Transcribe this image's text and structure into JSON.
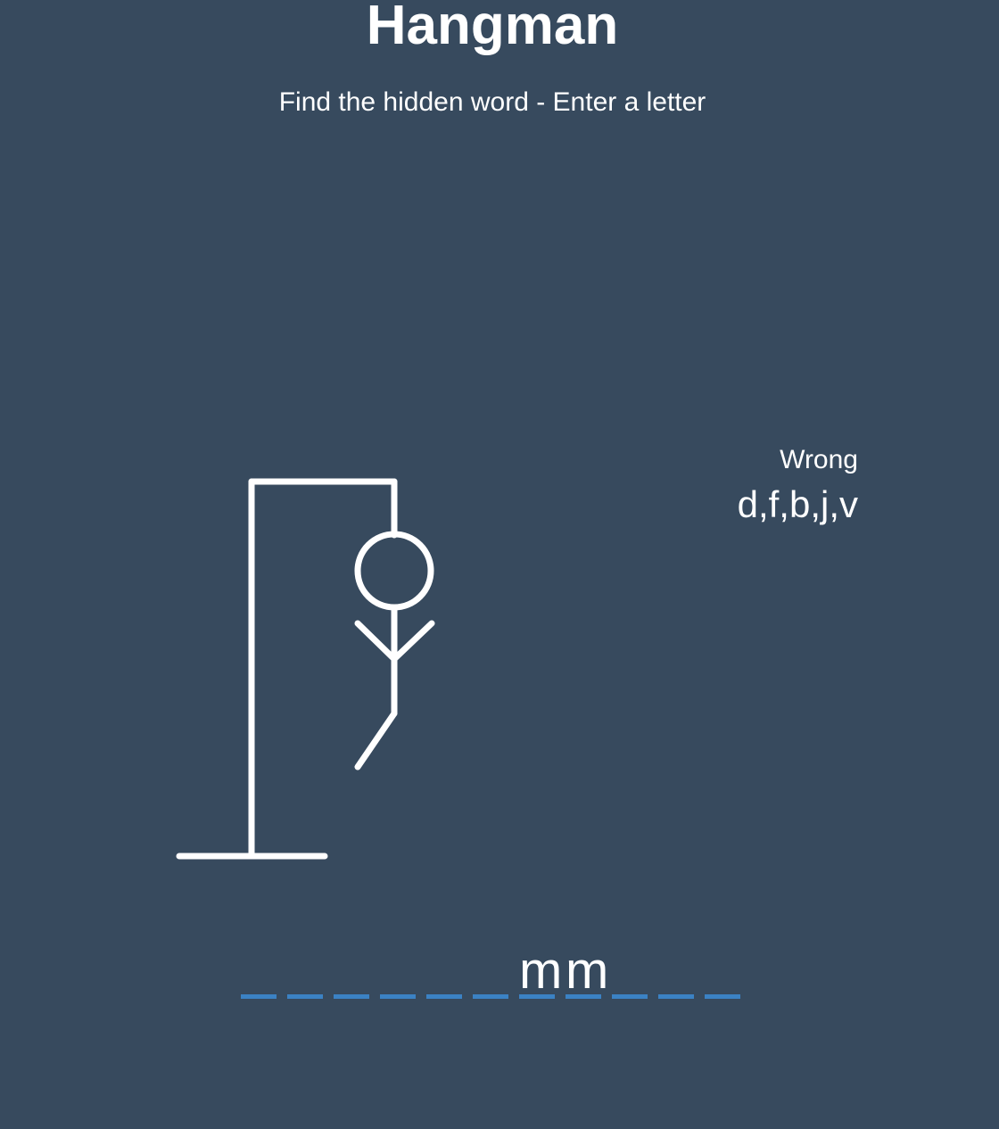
{
  "header": {
    "title": "Hangman",
    "subtitle": "Find the hidden word - Enter a letter"
  },
  "wrong": {
    "label": "Wrong",
    "letters": "d,f,b,j,v"
  },
  "word": {
    "letters": [
      "",
      "",
      "",
      "",
      "",
      "",
      "m",
      "m",
      "",
      "",
      "",
      ""
    ]
  },
  "colors": {
    "background": "#374a5e",
    "figure": "#ffffff",
    "slot_underline": "#3b82c4"
  },
  "game_state": {
    "wrong_count": 5,
    "visible_parts": [
      "ground",
      "pole",
      "beam",
      "rope",
      "head",
      "body",
      "arms",
      "left-leg"
    ]
  }
}
